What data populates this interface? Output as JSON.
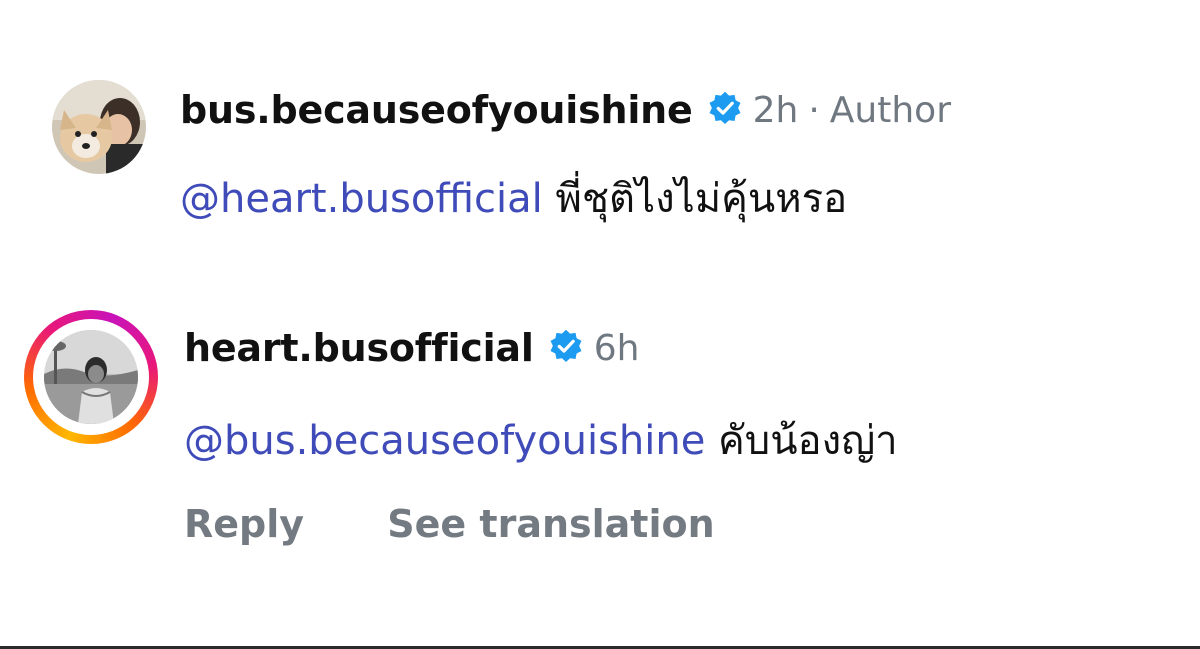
{
  "comments": [
    {
      "username": "bus.becauseofyouishine",
      "verified_icon": "verified-badge-icon",
      "time": "2h",
      "separator": "·",
      "tag": "Author",
      "mention": "@heart.busofficial",
      "text": "พี่ชุติไงไม่คุ้นหรอ",
      "avatar_icon": "dog-and-person-avatar"
    },
    {
      "username": "heart.busofficial",
      "verified_icon": "verified-badge-icon",
      "time": "6h",
      "mention": "@bus.becauseofyouishine",
      "text": "คับน้องญ่า",
      "avatar_icon": "person-at-beach-avatar",
      "has_story_ring": true
    }
  ],
  "actions": {
    "reply_label": "Reply",
    "translate_label": "See translation"
  },
  "colors": {
    "mention": "#3f4bb8",
    "meta": "#6f7780",
    "verified": "#1d9bf0",
    "action": "#737a82"
  }
}
